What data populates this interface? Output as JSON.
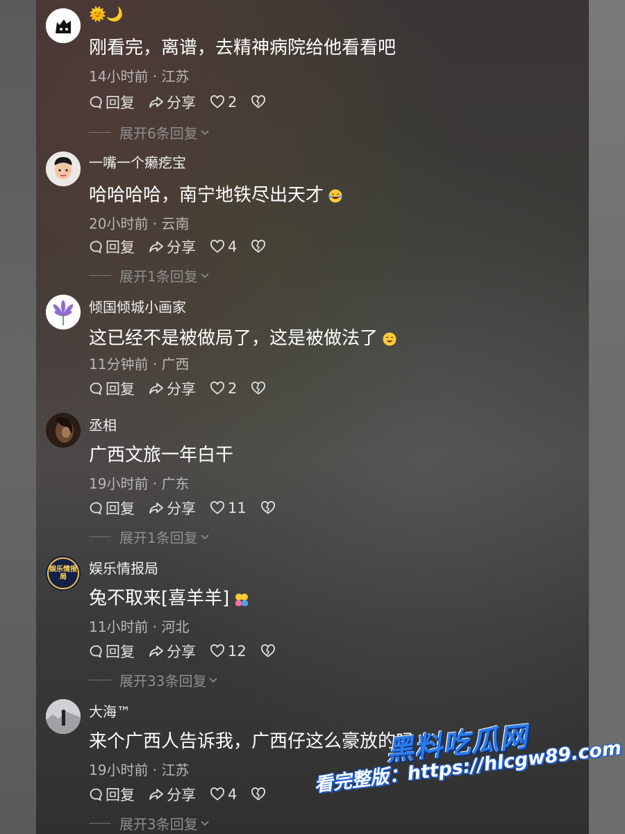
{
  "header": {
    "first_username_emoji": "🌞🌙"
  },
  "comments": [
    {
      "username": "",
      "text": "刚看完，离谱，去精神病院给他看看吧",
      "time": "14小时前",
      "location": "江苏",
      "reply": "回复",
      "share": "分享",
      "likes": "2",
      "expand": "展开6条回复"
    },
    {
      "username": "一嘴一个癞疙宝",
      "text": "哈哈哈哈，南宁地铁尽出天才",
      "time": "20小时前",
      "location": "云南",
      "reply": "回复",
      "share": "分享",
      "likes": "4",
      "expand": "展开1条回复"
    },
    {
      "username": "倾国倾城小画家",
      "text": "这已经不是被做局了，这是被做法了",
      "time": "11分钟前",
      "location": "广西",
      "reply": "回复",
      "share": "分享",
      "likes": "2",
      "expand": ""
    },
    {
      "username": "丞相",
      "text": "广西文旅一年白干",
      "time": "19小时前",
      "location": "广东",
      "reply": "回复",
      "share": "分享",
      "likes": "11",
      "expand": "展开1条回复"
    },
    {
      "username": "娱乐情报局",
      "avatar_text": "娱乐情报局",
      "text": "兔不取来[喜羊羊]",
      "time": "11小时前",
      "location": "河北",
      "reply": "回复",
      "share": "分享",
      "likes": "12",
      "expand": "展开33条回复"
    },
    {
      "username": "大海™",
      "text": "来个广西人告诉我，广西仔这么豪放的吗",
      "time": "19小时前",
      "location": "江苏",
      "reply": "回复",
      "share": "分享",
      "likes": "4",
      "expand": "展开3条回复"
    }
  ],
  "watermark": {
    "brand": "黑料吃瓜网",
    "line": "看完整版：https://hlcgw89.com"
  },
  "colors": {
    "panel_bg": "#3b3b37",
    "text": "#ffffff",
    "meta": "#b8b8b8",
    "watermark_blue": "#1f6fe0"
  }
}
